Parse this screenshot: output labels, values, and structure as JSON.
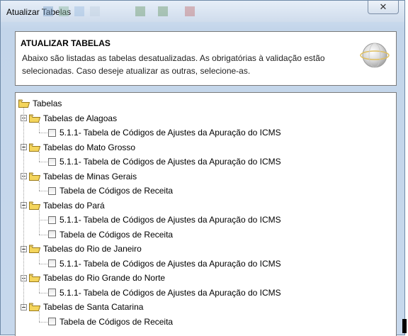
{
  "window": {
    "title": "Atualizar Tabelas",
    "close_label": "✕"
  },
  "header": {
    "title": "ATUALIZAR TABELAS",
    "description": "Abaixo são listadas as tabelas desatualizadas. As obrigatórias à validação estão selecionadas. Caso deseje atualizar as outras, selecione-as.",
    "logo_icon": "globe-icon"
  },
  "tree": {
    "root": {
      "label": "Tabelas",
      "icon": "folder-open-icon"
    },
    "groups": [
      {
        "label": "Tabelas de Alagoas",
        "items": [
          {
            "label": "5.1.1- Tabela de Códigos de Ajustes da Apuração do ICMS",
            "checked": false
          }
        ]
      },
      {
        "label": "Tabelas do Mato Grosso",
        "items": [
          {
            "label": "5.1.1- Tabela de Códigos de Ajustes da Apuração do ICMS",
            "checked": false
          }
        ]
      },
      {
        "label": "Tabelas de Minas Gerais",
        "items": [
          {
            "label": "Tabela de Códigos de Receita",
            "checked": false
          }
        ]
      },
      {
        "label": "Tabelas do Pará",
        "items": [
          {
            "label": "5.1.1- Tabela de Códigos de Ajustes da Apuração do ICMS",
            "checked": false
          },
          {
            "label": "Tabela de Códigos de Receita",
            "checked": false
          }
        ]
      },
      {
        "label": "Tabelas do Rio de Janeiro",
        "items": [
          {
            "label": "5.1.1- Tabela de Códigos de Ajustes da Apuração do ICMS",
            "checked": false
          }
        ]
      },
      {
        "label": "Tabelas do Rio Grande do Norte",
        "items": [
          {
            "label": "5.1.1- Tabela de Códigos de Ajustes da Apuração do ICMS",
            "checked": false
          }
        ]
      },
      {
        "label": "Tabelas de Santa Catarina",
        "items": [
          {
            "label": "Tabela de Códigos de Receita",
            "checked": false
          }
        ]
      }
    ]
  },
  "colors": {
    "folder_fill": "#f4d55c",
    "folder_stroke": "#9a7a1a",
    "window_bg": "#c7d8ec"
  }
}
